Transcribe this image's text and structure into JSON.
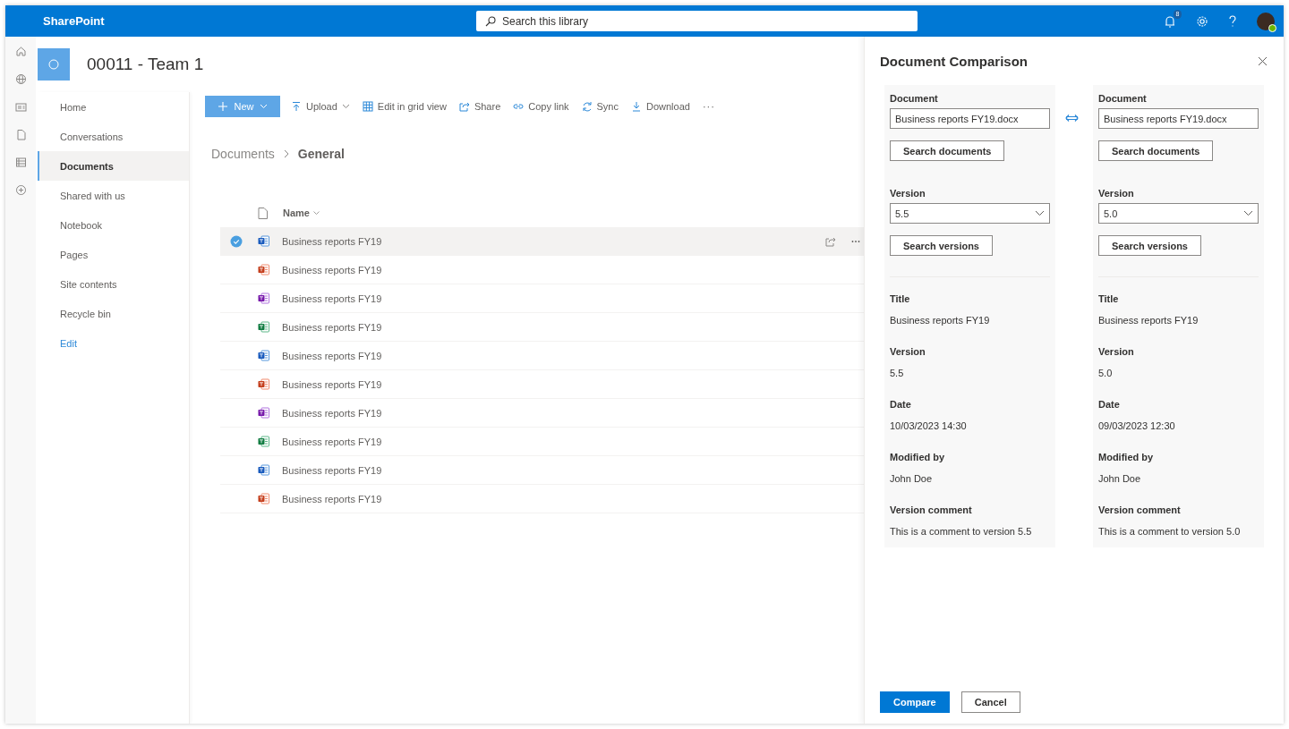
{
  "top_bar": {
    "app_name": "SharePoint",
    "search": {
      "placeholder": "Search this library"
    },
    "notification_count": "8"
  },
  "site": {
    "title": "00011 - Team 1"
  },
  "nav": [
    {
      "label": "Home",
      "kind": "item",
      "selected": false
    },
    {
      "label": "Conversations",
      "kind": "item",
      "selected": false
    },
    {
      "label": "Documents",
      "kind": "item",
      "selected": true
    },
    {
      "label": "Shared with us",
      "kind": "item",
      "selected": false
    },
    {
      "label": "Notebook",
      "kind": "item",
      "selected": false
    },
    {
      "label": "Pages",
      "kind": "item",
      "selected": false
    },
    {
      "label": "Site contents",
      "kind": "item",
      "selected": false
    },
    {
      "label": "Recycle bin",
      "kind": "item",
      "selected": false
    },
    {
      "label": "Edit",
      "kind": "link",
      "selected": false
    }
  ],
  "commands": [
    {
      "label": "New",
      "kind": "primary"
    },
    {
      "label": "Upload",
      "kind": "dropdown"
    },
    {
      "label": "Edit in grid view",
      "kind": "plain"
    },
    {
      "label": "Share",
      "kind": "plain"
    },
    {
      "label": "Copy link",
      "kind": "plain"
    },
    {
      "label": "Sync",
      "kind": "plain"
    },
    {
      "label": "Download",
      "kind": "plain"
    },
    {
      "label": "···",
      "kind": "more"
    }
  ],
  "breadcrumb": [
    {
      "label": "Documents",
      "current": false
    },
    {
      "label": "General",
      "current": true
    }
  ],
  "list": {
    "columns": [
      {
        "label": "Name"
      }
    ],
    "rows": [
      {
        "kind": "word",
        "name": "Business reports FY19",
        "selected": true
      },
      {
        "kind": "powerpoint",
        "name": "Business reports FY19",
        "selected": false
      },
      {
        "kind": "onenote",
        "name": "Business reports FY19",
        "selected": false
      },
      {
        "kind": "excel",
        "name": "Business reports FY19",
        "selected": false
      },
      {
        "kind": "word",
        "name": "Business reports FY19",
        "selected": false
      },
      {
        "kind": "powerpoint",
        "name": "Business reports FY19",
        "selected": false
      },
      {
        "kind": "onenote",
        "name": "Business reports FY19",
        "selected": false
      },
      {
        "kind": "excel",
        "name": "Business reports FY19",
        "selected": false
      },
      {
        "kind": "word",
        "name": "Business reports FY19",
        "selected": false
      },
      {
        "kind": "powerpoint",
        "name": "Business reports FY19",
        "selected": false
      }
    ]
  },
  "panel": {
    "title": "Document Comparison",
    "columns": [
      {
        "document_label": "Document",
        "document": "Business reports FY19.docx",
        "search_documents": "Search documents",
        "version_label": "Version",
        "version": "5.5",
        "search_versions": "Search versions",
        "details": [
          {
            "label": "Title",
            "value": "Business reports FY19"
          },
          {
            "label": "Version",
            "value": "5.5"
          },
          {
            "label": "Date",
            "value": "10/03/2023 14:30"
          },
          {
            "label": "Modified by",
            "value": "John Doe"
          },
          {
            "label": "Version comment",
            "value": "This is a comment to version 5.5"
          }
        ]
      },
      {
        "document_label": "Document",
        "document": "Business reports FY19.docx",
        "search_documents": "Search documents",
        "version_label": "Version",
        "version": "5.0",
        "search_versions": "Search versions",
        "details": [
          {
            "label": "Title",
            "value": "Business reports FY19"
          },
          {
            "label": "Version",
            "value": "5.0"
          },
          {
            "label": "Date",
            "value": "09/03/2023 12:30"
          },
          {
            "label": "Modified by",
            "value": "John Doe"
          },
          {
            "label": "Version comment",
            "value": "This is a comment to version 5.0"
          }
        ]
      }
    ],
    "buttons": [
      {
        "label": "Compare",
        "kind": "primary"
      },
      {
        "label": "Cancel",
        "kind": "default"
      }
    ]
  }
}
